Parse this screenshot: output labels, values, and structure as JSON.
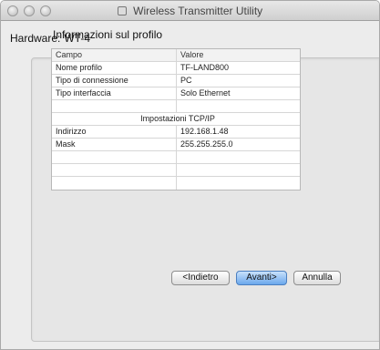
{
  "window": {
    "title": "Wireless Transmitter Utility"
  },
  "hardware": {
    "label": "Hardware:",
    "value": "WT-4"
  },
  "section": {
    "title": "Informazioni sul profilo"
  },
  "table": {
    "headers": [
      "Campo",
      "Valore"
    ],
    "rows": [
      [
        "Nome profilo",
        "TF-LAND800"
      ],
      [
        "Tipo di connessione",
        "PC"
      ],
      [
        "Tipo interfaccia",
        "Solo Ethernet"
      ],
      [
        "",
        ""
      ],
      [
        "Impostazioni TCP/IP"
      ],
      [
        "Indirizzo",
        "192.168.1.48"
      ],
      [
        "Mask",
        "255.255.255.0"
      ],
      [
        "",
        ""
      ],
      [
        "",
        ""
      ],
      [
        "",
        ""
      ]
    ]
  },
  "buttons": {
    "back": "<Indietro",
    "next": "Avanti>",
    "cancel": "Annulla"
  }
}
